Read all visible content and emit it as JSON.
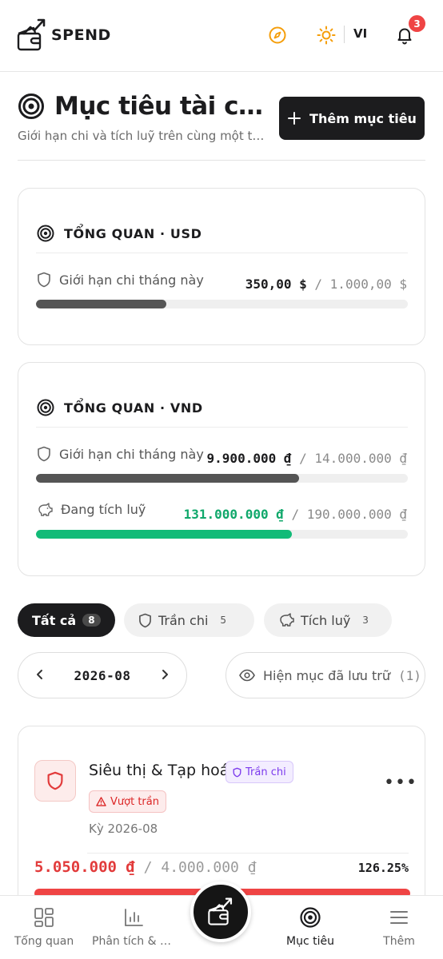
{
  "app": {
    "brand": "SPEND",
    "language": "VI",
    "notification_count": "3"
  },
  "page": {
    "title": "Mục tiêu tài chính",
    "subtitle": "Giới hạn chi và tích luỹ trên cùng một trang",
    "add_button": "Thêm mục tiêu"
  },
  "overview_usd": {
    "heading": "TỔNG QUAN · USD",
    "spending": {
      "label": "Giới hạn chi tháng này",
      "current": "350,00 $",
      "separator": " / ",
      "limit": "1.000,00 $",
      "progress": 0.35
    }
  },
  "overview_vnd": {
    "heading": "TỔNG QUAN · VND",
    "spending": {
      "label": "Giới hạn chi tháng này",
      "current": "9.900.000 ₫",
      "separator": " / ",
      "limit": "14.000.000 ₫",
      "progress": 0.707
    },
    "saving": {
      "label": "Đang tích luỹ",
      "current": "131.000.000 ₫",
      "separator": " / ",
      "limit": "190.000.000 ₫",
      "progress": 0.689
    }
  },
  "filters": [
    {
      "label": "Tất cả",
      "count": "8",
      "active": true
    },
    {
      "label": "Trần chi",
      "count": "5",
      "active": false
    },
    {
      "label": "Tích luỹ",
      "count": "3",
      "active": false
    }
  ],
  "period": {
    "value": "2026-08"
  },
  "archive": {
    "label": "Hiện mục đã lưu trữ",
    "count": "(1)"
  },
  "goal": {
    "name": "Siêu thị & Tạp hoá",
    "type_tag": "Trần chi",
    "status_tag": "Vượt trần",
    "period": "Kỳ 2026-08",
    "spent": "5.050.000 ₫",
    "separator": " / ",
    "limit": "4.000.000 ₫",
    "percent": "126.25%",
    "progress": 1.0,
    "more": "•••"
  },
  "nav": {
    "overview": "Tổng quan",
    "analytics": "Phân tích & Báo cáo",
    "goals": "Mục tiêu",
    "more": "Thêm"
  },
  "colors": {
    "accent_dark": "#1c1c1e",
    "danger": "#ef4444",
    "saving_green": "#12bb78",
    "compass_orange": "#f59e0b",
    "type_purple": "#7c3aed"
  }
}
